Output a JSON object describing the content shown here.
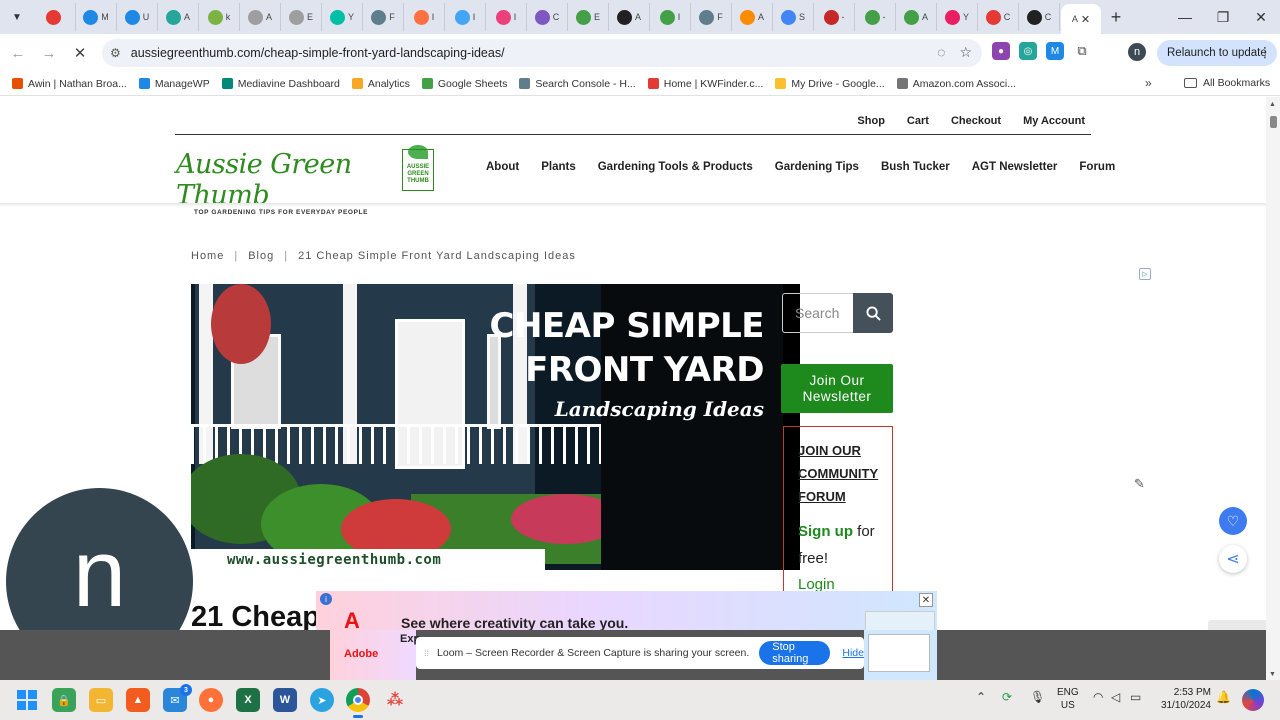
{
  "browser": {
    "tabs": [
      {
        "label": "",
        "color": "#e53935"
      },
      {
        "label": "M",
        "color": "#1e88e5"
      },
      {
        "label": "U",
        "color": "#1e88e5"
      },
      {
        "label": "A",
        "color": "#26a69a"
      },
      {
        "label": "k",
        "color": "#7cb342"
      },
      {
        "label": "A",
        "color": "#9e9e9e"
      },
      {
        "label": "E",
        "color": "#9e9e9e"
      },
      {
        "label": "Y",
        "color": "#00bfa5"
      },
      {
        "label": "F",
        "color": "#607d8b"
      },
      {
        "label": "I",
        "color": "#ff7043"
      },
      {
        "label": "I",
        "color": "#42a5f5"
      },
      {
        "label": "I",
        "color": "#ec407a"
      },
      {
        "label": "C",
        "color": "#7e57c2"
      },
      {
        "label": "E",
        "color": "#43a047"
      },
      {
        "label": "A",
        "color": "#212121"
      },
      {
        "label": "I",
        "color": "#43a047"
      },
      {
        "label": "F",
        "color": "#607d8b"
      },
      {
        "label": "A",
        "color": "#fb8c00"
      },
      {
        "label": "S",
        "color": "#4285f4"
      },
      {
        "label": "-",
        "color": "#c62828"
      },
      {
        "label": "-",
        "color": "#43a047"
      },
      {
        "label": "A",
        "color": "#43a047"
      },
      {
        "label": "Y",
        "color": "#e91e63"
      },
      {
        "label": "C",
        "color": "#e53935"
      },
      {
        "label": "C",
        "color": "#212121"
      }
    ],
    "active_tab_label": "A",
    "url": "aussiegreenthumb.com/cheap-simple-front-yard-landscaping-ideas/",
    "relaunch_label": "Relaunch to update",
    "profile_initial": "n",
    "bookmarks": [
      {
        "label": "Awin | Nathan Broa...",
        "color": "#e65100"
      },
      {
        "label": "ManageWP",
        "color": "#1e88e5"
      },
      {
        "label": "Mediavine Dashboard",
        "color": "#00897b"
      },
      {
        "label": "Analytics",
        "color": "#f9a825"
      },
      {
        "label": "Google Sheets",
        "color": "#43a047"
      },
      {
        "label": "Search Console - H...",
        "color": "#607d8b"
      },
      {
        "label": "Home | KWFinder.c...",
        "color": "#e53935"
      },
      {
        "label": "My Drive - Google...",
        "color": "#fbc02d"
      },
      {
        "label": "Amazon.com Associ...",
        "color": "#757575"
      }
    ],
    "all_bookmarks_label": "All Bookmarks"
  },
  "site": {
    "top_links": [
      "Shop",
      "Cart",
      "Checkout",
      "My Account"
    ],
    "logo_text": "Aussie Green Thumb",
    "logo_tagline": "TOP GARDENING TIPS FOR EVERYDAY PEOPLE",
    "logo_badge": "AUSSIE GREEN THUMB",
    "nav": [
      "About",
      "Plants",
      "Gardening Tools & Products",
      "Gardening Tips",
      "Bush Tucker",
      "AGT Newsletter",
      "Forum"
    ],
    "breadcrumb": {
      "home": "Home",
      "blog": "Blog",
      "current": "21 Cheap Simple Front Yard Landscaping Ideas"
    },
    "hero": {
      "line1": "CHEAP SIMPLE",
      "line2": "FRONT YARD",
      "line3": "Landscaping Ideas",
      "site_url": "www.aussiegreenthumb.com"
    },
    "search_placeholder": "Search",
    "newsletter_button": "Join Our Newsletter",
    "forum_box": {
      "title": "JOIN OUR COMMUNITY FORUM",
      "signup_strong": "Sign up",
      "signup_rest": " for free!",
      "login": "Login"
    },
    "article_title_partial": "21 Cheap",
    "ad_text": "See where creativity can take you.",
    "ad_brand": "Adobe",
    "ad_partial": "Exp"
  },
  "loom": {
    "message": "Loom – Screen Recorder & Screen Capture is sharing your screen.",
    "stop_label": "Stop sharing",
    "hide_label": "Hide"
  },
  "avatar_initial": "n",
  "taskbar": {
    "lang_top": "ENG",
    "lang_bottom": "US",
    "time": "2:53 PM",
    "date": "31/10/2024",
    "mail_badge": "3"
  },
  "colors": {
    "brand_green": "#1e8a1e",
    "forum_border": "#c0392b",
    "accent_blue": "#1a73e8"
  }
}
